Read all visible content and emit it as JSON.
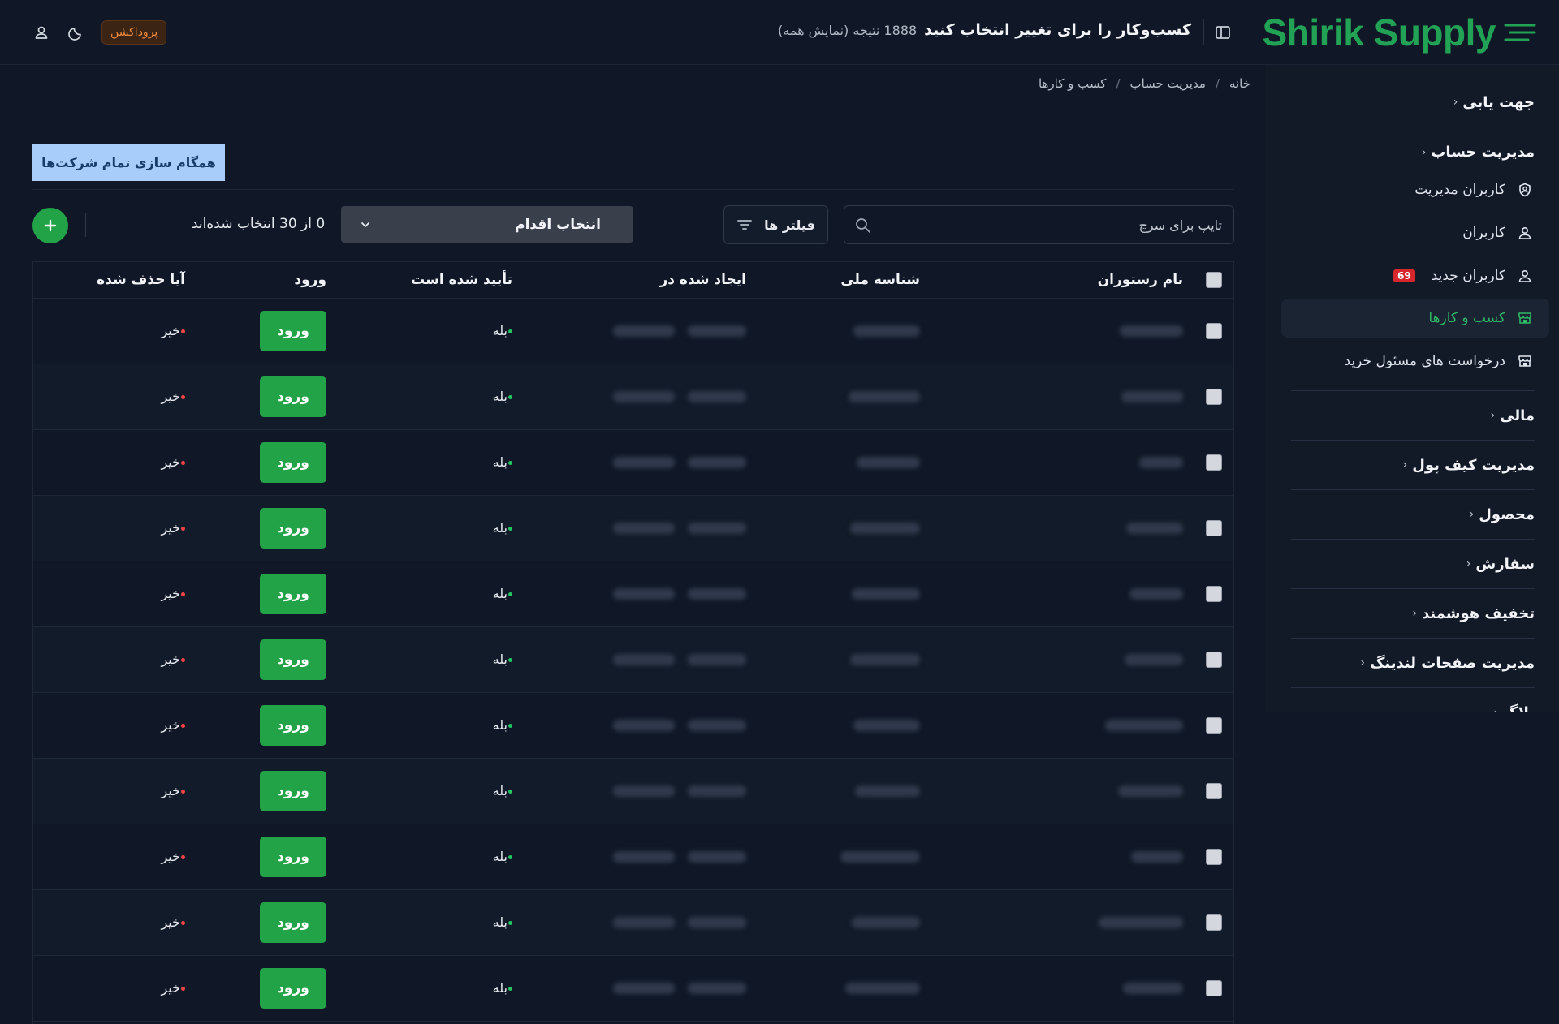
{
  "brand": {
    "logo_text": "Shirik Supply"
  },
  "header": {
    "title": "کسب‌وکار را برای تغییر انتخاب کنید",
    "result_count": "1888 نتیجه (نمایش همه)",
    "env_badge": "پروداکشن"
  },
  "sidebar": {
    "nav_heading": "جهت یابی",
    "account_heading": "مدیریت حساب",
    "items": [
      {
        "label": "کاربران مدیریت",
        "icon": "shield-user-icon"
      },
      {
        "label": "کاربران",
        "icon": "user-icon"
      },
      {
        "label": "کاربران جدید",
        "icon": "user-icon",
        "badge": "69"
      },
      {
        "label": "کسب و کارها",
        "icon": "store-icon",
        "active": true
      },
      {
        "label": "درخواست های مسئول خرید",
        "icon": "store-icon"
      }
    ],
    "sections": [
      "مالی",
      "مدیریت کیف پول",
      "محصول",
      "سفارش",
      "تخفیف هوشمند",
      "مدیریت صفحات لندینگ",
      "بلاگ"
    ]
  },
  "breadcrumb": [
    "خانه",
    "مدیریت حساب",
    "کسب و کارها"
  ],
  "toolbar": {
    "sync_label": "همگام سازی تمام شرکت‌ها",
    "search_placeholder": "تایپ برای سرچ",
    "filters_label": "فیلتر ها",
    "action_label": "انتخاب اقدام",
    "selected_text": "0 از 30 انتخاب شده‌اند"
  },
  "table": {
    "columns": [
      "نام رستوران",
      "شناسه ملی",
      "ایجاد شده در",
      "تأیید شده است",
      "ورود",
      "آیا حذف شده"
    ],
    "rows": [
      {
        "verified": "بله",
        "login": "ورود",
        "deleted": "خیر"
      },
      {
        "verified": "بله",
        "login": "ورود",
        "deleted": "خیر"
      },
      {
        "verified": "بله",
        "login": "ورود",
        "deleted": "خیر"
      },
      {
        "verified": "بله",
        "login": "ورود",
        "deleted": "خیر"
      },
      {
        "verified": "بله",
        "login": "ورود",
        "deleted": "خیر"
      },
      {
        "verified": "بله",
        "login": "ورود",
        "deleted": "خیر"
      },
      {
        "verified": "بله",
        "login": "ورود",
        "deleted": "خیر"
      },
      {
        "verified": "بله",
        "login": "ورود",
        "deleted": "خیر"
      },
      {
        "verified": "بله",
        "login": "ورود",
        "deleted": "خیر"
      },
      {
        "verified": "بله",
        "login": "ورود",
        "deleted": "خیر"
      },
      {
        "verified": "بله",
        "login": "ورود",
        "deleted": "خیر"
      }
    ]
  },
  "colors": {
    "background": "#101827",
    "sidebar": "#121a28",
    "accent_green": "#22a347",
    "brand_green": "#22a255",
    "sync_button": "#a9cdfa",
    "badge_red": "#d7262c",
    "prod_badge_text": "#f08a3c"
  }
}
